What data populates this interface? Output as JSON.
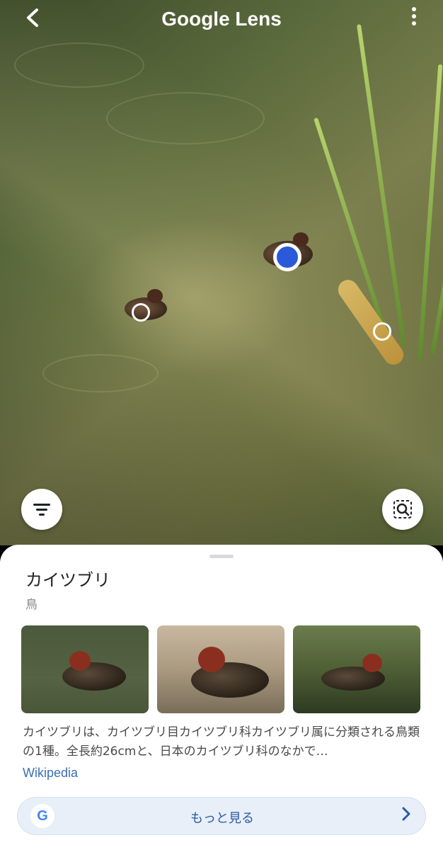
{
  "header": {
    "title": "Google Lens"
  },
  "result": {
    "name": "カイツブリ",
    "category": "鳥",
    "description": "カイツブリは、カイツブリ目カイツブリ科カイツブリ属に分類される鳥類の1種。全長約26cmと、日本のカイツブリ科のなかで…",
    "source": "Wikipedia"
  },
  "more_button": {
    "label": "もっと見る",
    "google_letter": "G"
  },
  "icons": {
    "back": "chevron-left-icon",
    "menu": "more-vert-icon",
    "filter": "filter-icon",
    "search_region": "search-region-icon",
    "more": "chevron-right-icon"
  },
  "colors": {
    "accent": "#2a5ad9",
    "link": "#3b6fb6",
    "button_bg": "#e8eff9",
    "button_text": "#2a5aa0"
  }
}
